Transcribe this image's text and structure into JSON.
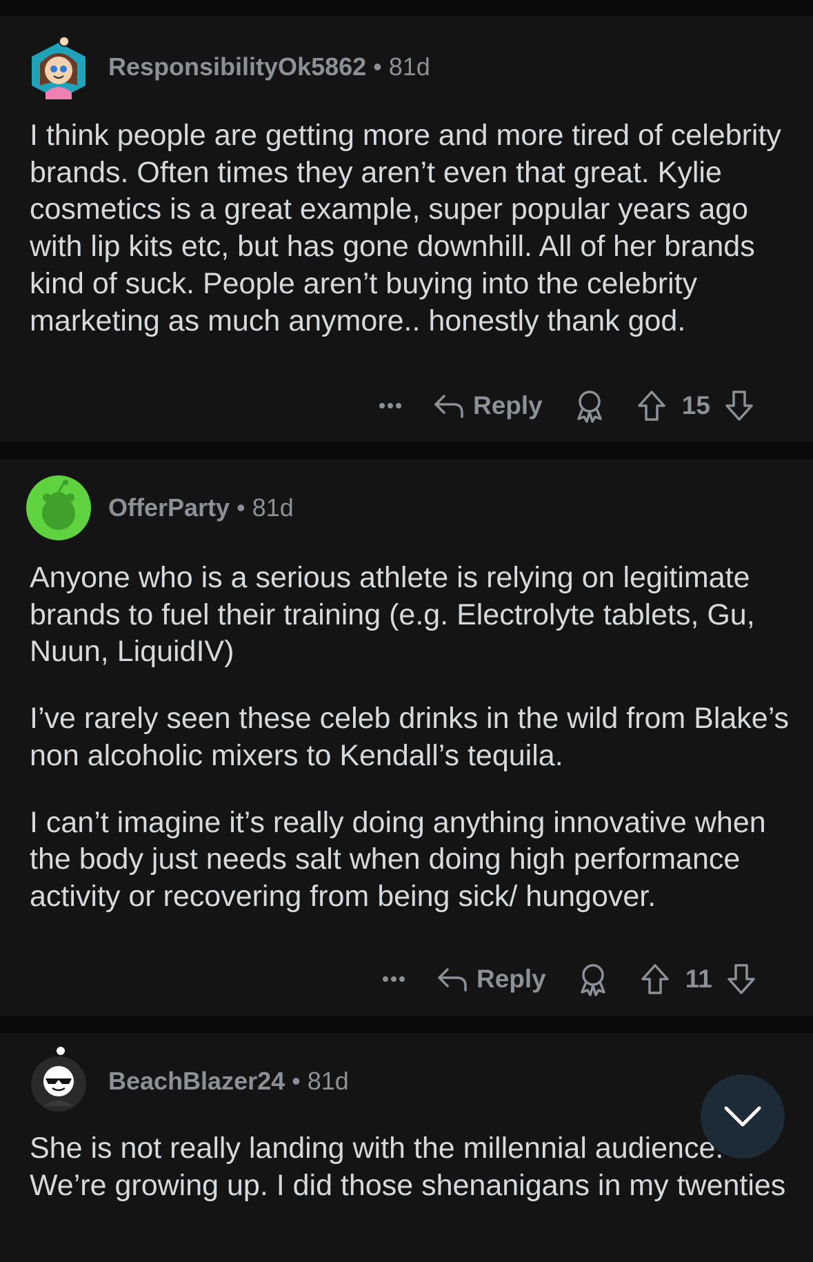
{
  "comments": [
    {
      "username": "ResponsibilityOk5862",
      "separator": "•",
      "age": "81d",
      "paragraphs": [
        "I think people are getting more and more tired of celebrity brands. Often times they aren’t even that great. Kylie cosmetics is a great example, super popular years ago with lip kits etc, but has gone downhill. All of her brands kind of suck. People aren’t buying into the celebrity marketing as much anymore.. honestly thank god."
      ],
      "reply_label": "Reply",
      "score": "15"
    },
    {
      "username": "OfferParty",
      "separator": "•",
      "age": "81d",
      "paragraphs": [
        "Anyone who is a serious athlete is relying on legitimate brands to fuel their training (e.g. Electrolyte tablets, Gu, Nuun, LiquidIV)",
        "I’ve rarely seen these celeb drinks in the wild from Blake’s non alcoholic mixers to Kendall’s tequila.",
        "I can’t imagine it’s really doing anything innovative when the body just needs salt when doing high performance activity or recovering from being sick/ hungover."
      ],
      "reply_label": "Reply",
      "score": "11"
    },
    {
      "username": "BeachBlazer24",
      "separator": "•",
      "age": "81d",
      "paragraphs": [
        "She is not really landing with the millennial audience. We’re growing up. I did those shenanigans in my twenties"
      ]
    }
  ],
  "icons": {
    "more": "more-dots-icon",
    "reply": "reply-arrow-icon",
    "award": "award-icon",
    "upvote": "upvote-arrow-icon",
    "downvote": "downvote-arrow-icon",
    "scroll": "chevron-down-icon"
  },
  "colors": {
    "background": "#141414",
    "separator": "#0b0b0b",
    "text": "#d7dadc",
    "muted": "#8b9196",
    "fab": "#1d2b36",
    "avatar_green": "#5ed33f"
  }
}
